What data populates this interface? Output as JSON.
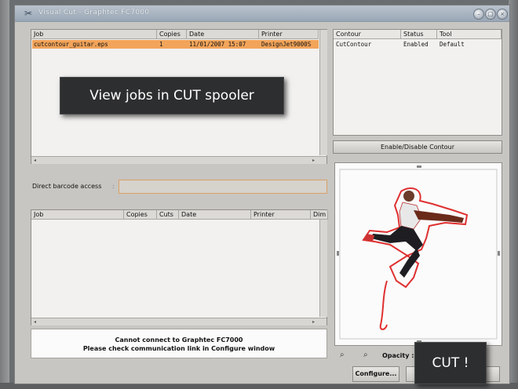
{
  "window": {
    "title": "Visual Cut - Graphtec FC7000"
  },
  "jobs_table": {
    "columns": [
      "Job",
      "Copies",
      "Date",
      "Printer"
    ],
    "rows": [
      {
        "job": "cutcontour_guitar.eps",
        "copies": "1",
        "date": "11/01/2007 15:07",
        "printer": "DesignJet9000S"
      }
    ]
  },
  "contour_table": {
    "columns": [
      "Contour",
      "Status",
      "Tool"
    ],
    "rows": [
      {
        "contour": "CutContour",
        "status": "Enabled",
        "tool": "Default"
      }
    ]
  },
  "enable_contour_button": "Enable/Disable Contour",
  "barcode": {
    "label": "Direct barcode access",
    "value": ""
  },
  "cut_table": {
    "columns": [
      "Job",
      "Copies",
      "Cuts",
      "Date",
      "Printer",
      "Dim"
    ]
  },
  "status_message": {
    "line1": "Cannot connect to Graphtec FC7000",
    "line2": "Please check communication link in Configure window"
  },
  "opacity_label": "Opacity :",
  "configure_button": "Configure...",
  "callouts": {
    "spooler": "View jobs in CUT spooler",
    "cut": "CUT !"
  },
  "colors": {
    "selected_row": "#f2a45a",
    "barcode_border": "#d9a066",
    "contour_path": "#e03030"
  }
}
